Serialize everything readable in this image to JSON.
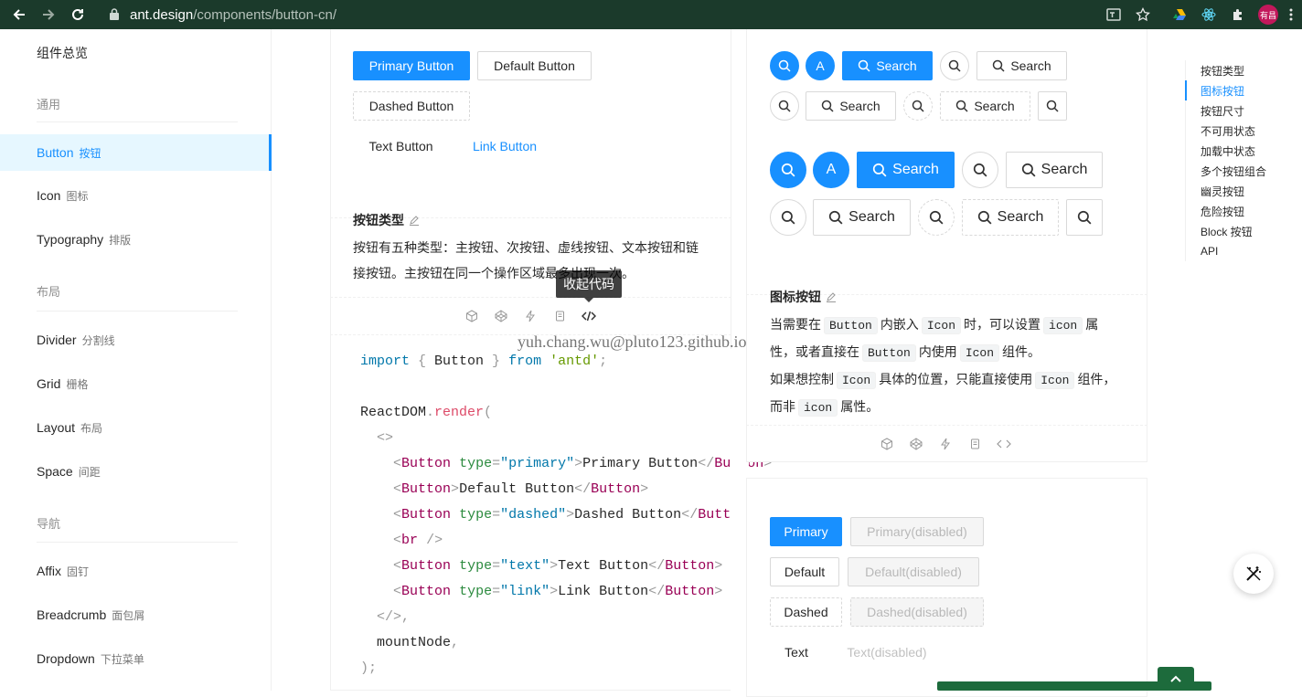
{
  "browser": {
    "url_host": "ant.design",
    "url_path": "/components/button-cn/",
    "avatar_text": "有昌"
  },
  "sidebar": {
    "title": "组件总览",
    "groups": [
      {
        "label": "通用"
      },
      {
        "label": "布局"
      },
      {
        "label": "导航"
      }
    ],
    "items": [
      {
        "label": "Button",
        "cn": "按钮",
        "active": true
      },
      {
        "label": "Icon",
        "cn": "图标"
      },
      {
        "label": "Typography",
        "cn": "排版"
      },
      {
        "label": "Divider",
        "cn": "分割线"
      },
      {
        "label": "Grid",
        "cn": "栅格"
      },
      {
        "label": "Layout",
        "cn": "布局"
      },
      {
        "label": "Space",
        "cn": "间距"
      },
      {
        "label": "Affix",
        "cn": "固钉"
      },
      {
        "label": "Breadcrumb",
        "cn": "面包屑"
      },
      {
        "label": "Dropdown",
        "cn": "下拉菜单"
      }
    ]
  },
  "demo_types": {
    "buttons": {
      "primary": "Primary Button",
      "default": "Default Button",
      "dashed": "Dashed Button",
      "text": "Text Button",
      "link": "Link Button"
    },
    "title": "按钮类型",
    "desc": "按钮有五种类型：主按钮、次按钮、虚线按钮、文本按钮和链接按钮。主按钮在同一个操作区域最多出现一次。",
    "tooltip": "收起代码"
  },
  "code_demo": {
    "import_kw": "import",
    "import_body": " { Button } ",
    "from_kw": "from",
    "module": "'antd'",
    "render_obj": "ReactDOM",
    "render_fn": "render",
    "lines": [
      {
        "type": "primary",
        "label": "Primary Button"
      },
      {
        "type": null,
        "label": "Default Button"
      },
      {
        "type": "dashed",
        "label": "Dashed Button"
      },
      {
        "type": "text",
        "label": "Text Button"
      },
      {
        "type": "link",
        "label": "Link Button"
      }
    ],
    "mount": "mountNode"
  },
  "watermark": "yuh.chang.wu@pluto123.github.io",
  "demo_icons": {
    "search_label": "Search",
    "letter": "A",
    "title": "图标按钮",
    "desc_line1a": "当需要在",
    "code_button": "Button",
    "desc_line1b": "内嵌入",
    "code_Icon": "Icon",
    "desc_line1c": "时，可以设置",
    "code_icon": "icon",
    "desc_line1d": "属",
    "desc_line2a": "性，或者直接在",
    "desc_line2b": "内使用",
    "desc_line2c": "组件。",
    "desc_line3a": "如果想控制",
    "desc_line3b": "具体的位置，只能直接使用",
    "desc_line3c": "组件，",
    "desc_line4a": "而非",
    "desc_line4b": "属性。"
  },
  "demo_disabled": {
    "primary": "Primary",
    "primary_dis": "Primary(disabled)",
    "default": "Default",
    "default_dis": "Default(disabled)",
    "dashed": "Dashed",
    "dashed_dis": "Dashed(disabled)",
    "text": "Text",
    "text_dis": "Text(disabled)"
  },
  "toc": [
    {
      "label": "按钮类型"
    },
    {
      "label": "图标按钮",
      "active": true
    },
    {
      "label": "按钮尺寸"
    },
    {
      "label": "不可用状态"
    },
    {
      "label": "加载中状态"
    },
    {
      "label": "多个按钮组合"
    },
    {
      "label": "幽灵按钮"
    },
    {
      "label": "危险按钮"
    },
    {
      "label": "Block 按钮"
    },
    {
      "label": "API"
    }
  ],
  "colors": {
    "primary": "#1890ff",
    "chrome_bg": "#1b3a2b"
  }
}
